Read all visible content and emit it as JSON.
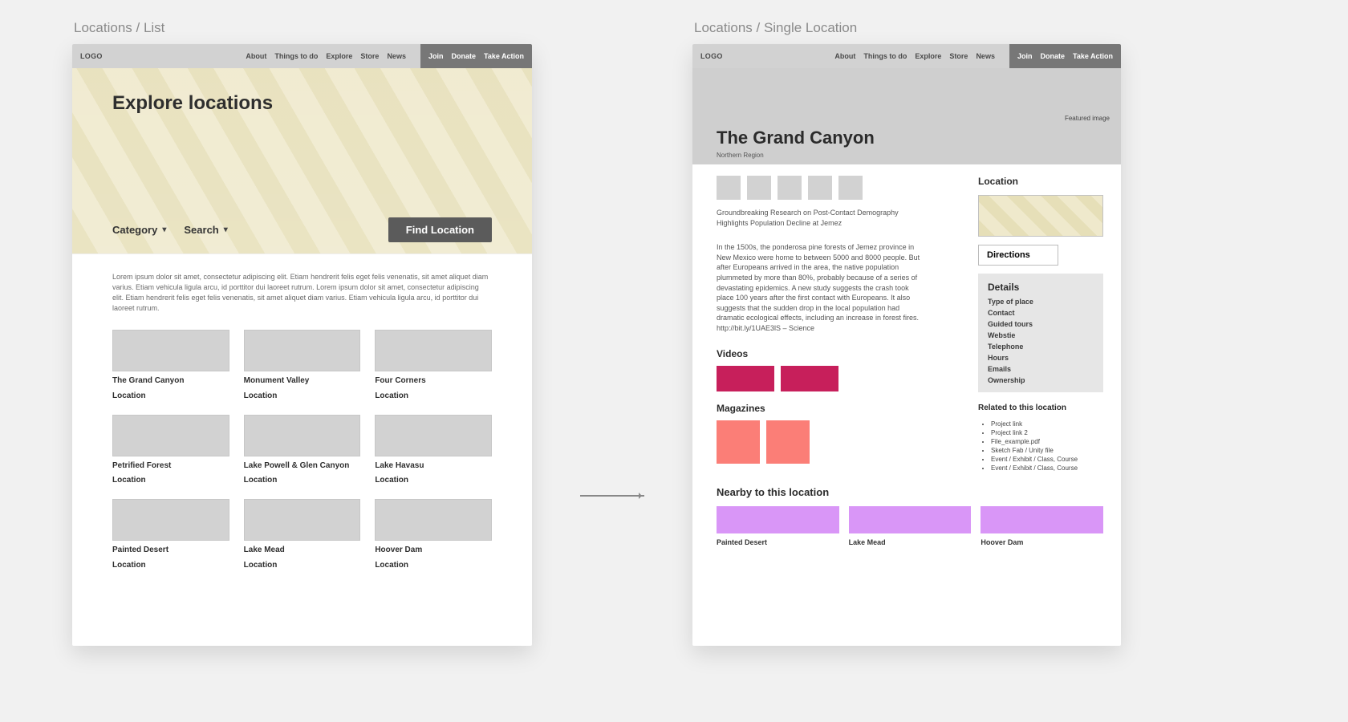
{
  "shared_header": {
    "logo": "LOGO",
    "nav": [
      "About",
      "Things to do",
      "Explore",
      "Store",
      "News"
    ],
    "cta": [
      "Join",
      "Donate",
      "Take Action"
    ]
  },
  "list_screen": {
    "label": "Locations / List",
    "hero_title": "Explore locations",
    "filters": {
      "category_label": "Category",
      "search_label": "Search",
      "button": "Find Location"
    },
    "intro": "Lorem ipsum dolor sit amet, consectetur adipiscing elit. Etiam hendrerit felis eget felis venenatis, sit amet aliquet diam varius. Etiam vehicula ligula arcu, id porttitor dui laoreet rutrum. Lorem ipsum dolor sit amet, consectetur adipiscing elit. Etiam hendrerit felis eget felis venenatis, sit amet aliquet diam varius. Etiam vehicula ligula arcu, id porttitor dui laoreet rutrum.",
    "cards": [
      {
        "title": "The Grand Canyon",
        "sub": "Location"
      },
      {
        "title": "Monument Valley",
        "sub": "Location"
      },
      {
        "title": "Four Corners",
        "sub": "Location"
      },
      {
        "title": "Petrified Forest",
        "sub": "Location"
      },
      {
        "title": "Lake Powell & Glen Canyon",
        "sub": "Location"
      },
      {
        "title": "Lake Havasu",
        "sub": "Location"
      },
      {
        "title": "Painted Desert",
        "sub": "Location"
      },
      {
        "title": "Lake Mead",
        "sub": "Location"
      },
      {
        "title": "Hoover Dam",
        "sub": "Location"
      }
    ]
  },
  "single_screen": {
    "label": "Locations / Single Location",
    "featured_label": "Featured image",
    "title": "The Grand Canyon",
    "subtitle": "Northern Region",
    "desc_line1": "Groundbreaking Research on Post-Contact Demography Highlights Population Decline at Jemez",
    "desc_body": "In the 1500s, the ponderosa pine forests of Jemez province in New Mexico were home to between 5000 and 8000 people. But after Europeans arrived in the area, the native population plummeted by more than 80%, probably because of a series of devastating epidemics. A new study suggests the crash took place 100 years after the first contact with Europeans. It also suggests that the sudden drop in the local population had dramatic ecological effects, including an increase in forest fires. http://bit.ly/1UAE3lS – Science",
    "videos_heading": "Videos",
    "magazines_heading": "Magazines",
    "side": {
      "location_heading": "Location",
      "directions_button": "Directions",
      "details_heading": "Details",
      "details_items": [
        "Type of place",
        "Contact",
        "Guided tours",
        "Webstie",
        "Telephone",
        "Hours",
        "Emails",
        "Ownership"
      ],
      "related_heading": "Related to this location",
      "related_items": [
        "Project link",
        "Project link 2",
        "File_example.pdf",
        "Sketch Fab / Unity file",
        "Event / Exhibit / Class, Course",
        "Event / Exhibit / Class, Course"
      ]
    },
    "nearby_heading": "Nearby to this location",
    "nearby": [
      "Painted Desert",
      "Lake Mead",
      "Hoover Dam"
    ]
  }
}
